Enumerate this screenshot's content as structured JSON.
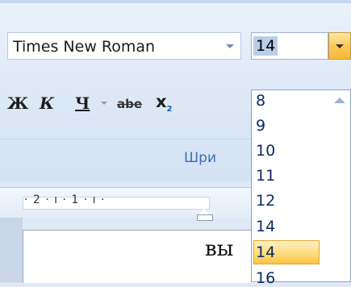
{
  "font": {
    "name_value": "Times New Roman",
    "size_value": "14"
  },
  "format_buttons": {
    "bold": "Ж",
    "italic": "К",
    "underline": "Ч",
    "strikethrough": "abe",
    "subscript": "x",
    "subscript_mark": "2"
  },
  "group": {
    "label": "Шри"
  },
  "ruler": {
    "text": "· 2 · ı · 1 · ı ·"
  },
  "document": {
    "text": "вы"
  },
  "size_list": {
    "items": [
      "8",
      "9",
      "10",
      "11",
      "12",
      "14",
      "16"
    ],
    "selected": "14"
  },
  "colors": {
    "ribbon": "#dde8f5",
    "accent": "#fbc85a",
    "selection": "#b9cde9",
    "list_text": "#0b2a66"
  }
}
